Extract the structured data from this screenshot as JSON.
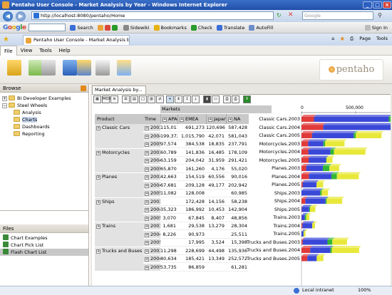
{
  "window": {
    "title": "Pentaho User Console - Market Analysis by Year - Windows Internet Explorer"
  },
  "address": {
    "url": "http://localhost:8080/pentaho/Home"
  },
  "ie_search": {
    "placeholder": "Google"
  },
  "google_toolbar": {
    "logo": "Google",
    "search_label": "Search",
    "sidewiki_label": "Sidewiki",
    "bookmarks_label": "Bookmarks",
    "check_label": "Check",
    "translate_label": "Translate",
    "autofill_label": "AutoFill",
    "signin_label": "Sign In"
  },
  "browser_tab": {
    "label": "Pentaho User Console - Market Analysis by Year"
  },
  "command_bar": {
    "page_label": "Page",
    "tools_label": "Tools"
  },
  "menubar": {
    "items": [
      "File",
      "View",
      "Tools",
      "Help"
    ]
  },
  "logo": {
    "text": "pentaho"
  },
  "browse": {
    "title": "Browse",
    "tree": [
      {
        "label": "BI Developer Examples",
        "expanded": false
      },
      {
        "label": "Steel Wheels",
        "expanded": true
      },
      {
        "label": "Analysis"
      },
      {
        "label": "Charts"
      },
      {
        "label": "Dashboards"
      },
      {
        "label": "Reporting"
      }
    ]
  },
  "files": {
    "title": "Files",
    "items": [
      "Chart Examples",
      "Chart Pick List",
      "Flash Chart List"
    ]
  },
  "doc_tab": {
    "label": "Market Analysis by..."
  },
  "pivot": {
    "markets_label": "Markets",
    "product_label": "Product",
    "time_label": "Time",
    "columns": [
      "APAC",
      "EMEA",
      "Japan",
      "NA"
    ],
    "groups": [
      {
        "product": "Classic Cars",
        "rows": [
          {
            "year": "2003",
            "values": [
              "115,011",
              "691,273",
              "120,696",
              "587,428"
            ]
          },
          {
            "year": "2004",
            "values": [
              "199,372",
              "1,015,790",
              "42,071",
              "581,043"
            ]
          },
          {
            "year": "2005",
            "values": [
              "97,574",
              "384,538",
              "18,835",
              "237,791"
            ]
          }
        ]
      },
      {
        "product": "Motorcycles",
        "rows": [
          {
            "year": "2003",
            "values": [
              "60,789",
              "141,836",
              "16,485",
              "178,109"
            ]
          },
          {
            "year": "2004",
            "values": [
              "63,159",
              "204,042",
              "31,959",
              "291,421"
            ]
          },
          {
            "year": "2005",
            "values": [
              "65,870",
              "161,260",
              "4,176",
              "55,020"
            ]
          }
        ]
      },
      {
        "product": "Planes",
        "rows": [
          {
            "year": "2003",
            "values": [
              "42,663",
              "154,519",
              "60,556",
              "90,016"
            ]
          },
          {
            "year": "2004",
            "values": [
              "67,681",
              "209,128",
              "49,177",
              "202,942"
            ]
          },
          {
            "year": "2005",
            "values": [
              "11,082",
              "128,008",
              "",
              "60,985"
            ]
          }
        ]
      },
      {
        "product": "Ships",
        "rows": [
          {
            "year": "2003",
            "values": [
              "",
              "172,428",
              "14,156",
              "58,238"
            ]
          },
          {
            "year": "2004",
            "values": [
              "35,323",
              "186,992",
              "10,453",
              "142,904"
            ]
          },
          {
            "year": "2005",
            "values": [
              "3,070",
              "67,845",
              "8,407",
              "48,856"
            ]
          }
        ]
      },
      {
        "product": "Trains",
        "rows": [
          {
            "year": "2003",
            "values": [
              "1,681",
              "29,538",
              "13,279",
              "28,304"
            ]
          },
          {
            "year": "2004",
            "values": [
              "8,226",
              "90,973",
              "",
              "25,511"
            ]
          },
          {
            "year": "2005",
            "values": [
              "",
              "17,995",
              "3,524",
              "15,398"
            ]
          }
        ]
      },
      {
        "product": "Trucks and Buses",
        "rows": [
          {
            "year": "2003",
            "values": [
              "11,298",
              "228,699",
              "44,498",
              "135,936"
            ]
          },
          {
            "year": "2004",
            "values": [
              "80,634",
              "185,421",
              "13,349",
              "252,572"
            ]
          },
          {
            "year": "2005",
            "values": [
              "53,735",
              "86,859",
              "",
              "61,281"
            ]
          }
        ]
      }
    ]
  },
  "chart_data": {
    "type": "bar",
    "orientation": "horizontal",
    "stacked": true,
    "categories": [
      "Classic Cars.2003",
      "Classic Cars.2004",
      "Classic Cars.2005",
      "Motorcycles.2003",
      "Motorcycles.2004",
      "Motorcycles.2005",
      "Planes.2003",
      "Planes.2004",
      "Planes.2005",
      "Ships.2003",
      "Ships.2004",
      "Ships.2005",
      "Trains.2003",
      "Trains.2004",
      "Trains.2005",
      "Trucks and Buses.2003",
      "Trucks and Buses.2004",
      "Trucks and Buses.2005"
    ],
    "series": [
      {
        "color": "#e03a3a",
        "values": [
          115011,
          199372,
          97574,
          60789,
          63159,
          65870,
          42663,
          67681,
          11082,
          0,
          35323,
          3070,
          1681,
          8226,
          0,
          11298,
          80634,
          53735
        ]
      },
      {
        "color": "#3a48d8",
        "values": [
          691273,
          1015790,
          384538,
          141836,
          204042,
          161260,
          154519,
          209128,
          128008,
          172428,
          186992,
          67845,
          29538,
          90973,
          17995,
          228699,
          185421,
          86859
        ]
      },
      {
        "color": "#33b833",
        "values": [
          120696,
          42071,
          18835,
          16485,
          31959,
          4176,
          60556,
          49177,
          0,
          14156,
          10453,
          8407,
          13279,
          0,
          3524,
          44498,
          13349,
          0
        ]
      },
      {
        "color": "#e8e83a",
        "values": [
          587428,
          581043,
          237791,
          178109,
          291421,
          55020,
          90016,
          202942,
          60985,
          58238,
          142904,
          48856,
          28304,
          25511,
          15398,
          135936,
          252572,
          61281
        ]
      }
    ],
    "xticks": [
      "0",
      "500,000",
      "1"
    ],
    "xlim": [
      0,
      1000000
    ]
  },
  "statusbar": {
    "zone": "Local intranet",
    "zoom": "100%"
  }
}
